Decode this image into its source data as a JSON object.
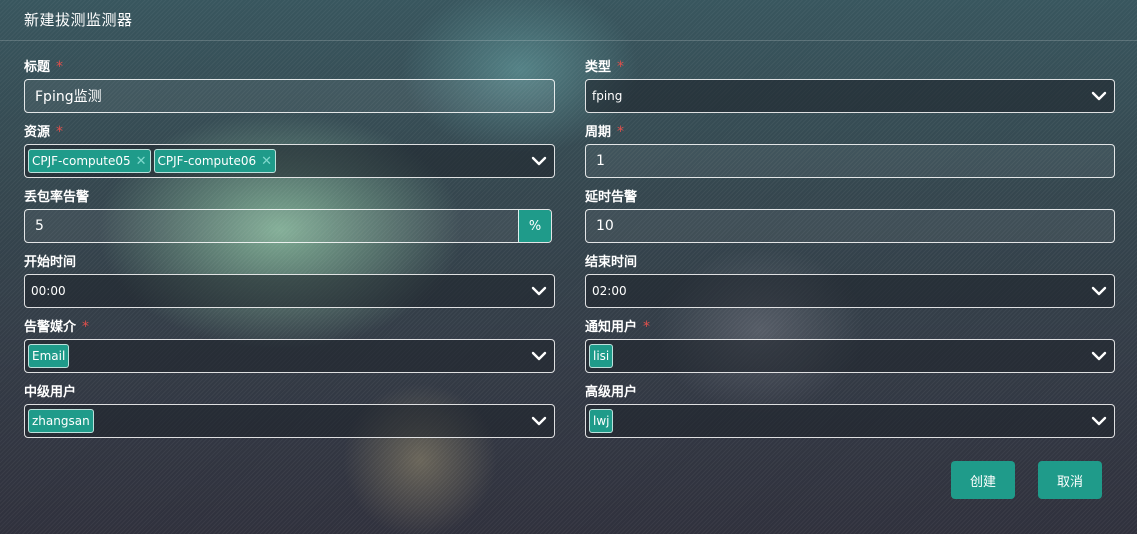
{
  "dialog": {
    "title": "新建拔测监测器"
  },
  "form": {
    "title": {
      "label": "标题",
      "required_mark": "*",
      "value": "Fping监测"
    },
    "type": {
      "label": "类型",
      "required_mark": "*",
      "value": "fping"
    },
    "resources": {
      "label": "资源",
      "required_mark": "*",
      "tags": [
        "CPJF-compute05",
        "CPJF-compute06"
      ],
      "remove_glyph": "✕"
    },
    "period": {
      "label": "周期",
      "required_mark": "*",
      "value": "1"
    },
    "loss_alarm": {
      "label": "丢包率告警",
      "value": "5",
      "unit": "%"
    },
    "delay_alarm": {
      "label": "延时告警",
      "value": "10"
    },
    "start_time": {
      "label": "开始时间",
      "value": "00:00"
    },
    "end_time": {
      "label": "结束时间",
      "value": "02:00"
    },
    "alarm_media": {
      "label": "告警媒介",
      "required_mark": "*",
      "tags": [
        "Email"
      ]
    },
    "notify_users": {
      "label": "通知用户",
      "required_mark": "*",
      "tags": [
        "lisi"
      ]
    },
    "mid_users": {
      "label": "中级用户",
      "tags": [
        "zhangsan"
      ]
    },
    "senior_users": {
      "label": "高级用户",
      "tags": [
        "lwj"
      ]
    }
  },
  "buttons": {
    "create": "创建",
    "cancel": "取消"
  },
  "colors": {
    "accent": "#1f9b8a",
    "required": "#e2504c"
  },
  "icons": {
    "dropdown": "chevron-down-icon",
    "tag_remove": "close-icon"
  }
}
